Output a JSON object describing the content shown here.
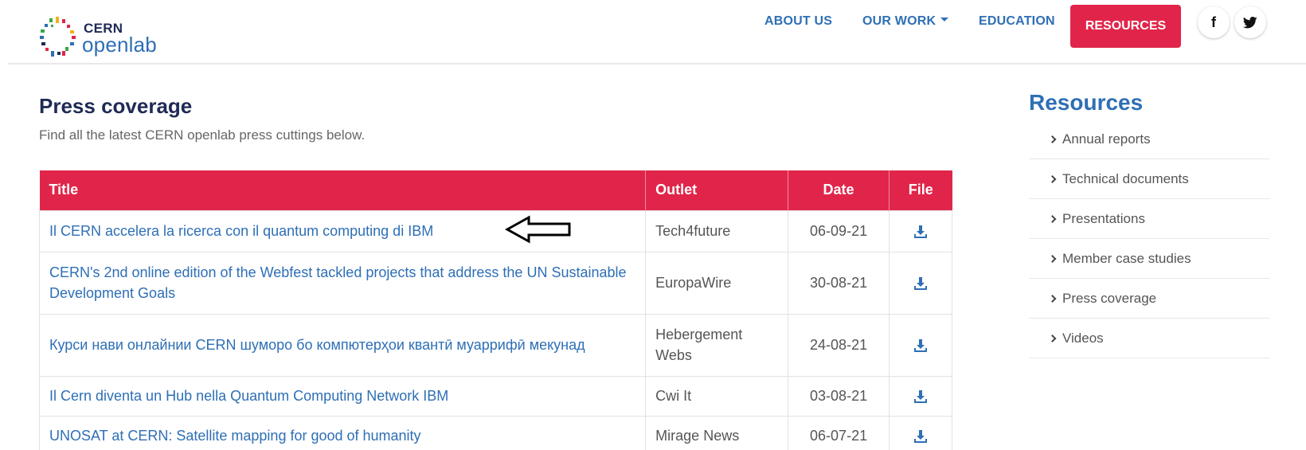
{
  "logo": {
    "line1": "CERN",
    "line2": "openlab"
  },
  "nav": {
    "about": "ABOUT US",
    "work": "OUR WORK",
    "education": "EDUCATION",
    "resources": "RESOURCES",
    "facebook": "f"
  },
  "main": {
    "title": "Press coverage",
    "subtitle": "Find all the latest CERN openlab press cuttings below."
  },
  "table": {
    "headers": {
      "title": "Title",
      "outlet": "Outlet",
      "date": "Date",
      "file": "File"
    },
    "rows": [
      {
        "title": "Il CERN accelera la ricerca con il quantum computing di IBM",
        "outlet": "Tech4future",
        "date": "06-09-21"
      },
      {
        "title": "CERN's 2nd online edition of the Webfest tackled projects that address the UN Sustainable Development Goals",
        "outlet": "EuropaWire",
        "date": "30-08-21"
      },
      {
        "title": "Курси нави онлайнии CERN шуморо бо компютерҳои квантӣ муаррифӣ мекунад",
        "outlet": "Hebergement Webs",
        "date": "24-08-21"
      },
      {
        "title": "Il Cern diventa un Hub nella Quantum Computing Network IBM",
        "outlet": "Cwi It",
        "date": "03-08-21"
      },
      {
        "title": "UNOSAT at CERN: Satellite mapping for good of humanity",
        "outlet": "Mirage News",
        "date": "06-07-21"
      }
    ]
  },
  "sidebar": {
    "title": "Resources",
    "items": [
      {
        "label": "Annual reports"
      },
      {
        "label": "Technical documents"
      },
      {
        "label": "Presentations"
      },
      {
        "label": "Member case studies"
      },
      {
        "label": "Press coverage"
      },
      {
        "label": "Videos"
      }
    ]
  },
  "colors": {
    "accent": "#e1254a",
    "link": "#2e6fb5",
    "heading": "#1f2a55"
  },
  "icons": {
    "download": "download-icon",
    "facebook": "facebook-icon",
    "twitter": "twitter-icon",
    "arrow": "left-arrow-annotation-icon"
  }
}
